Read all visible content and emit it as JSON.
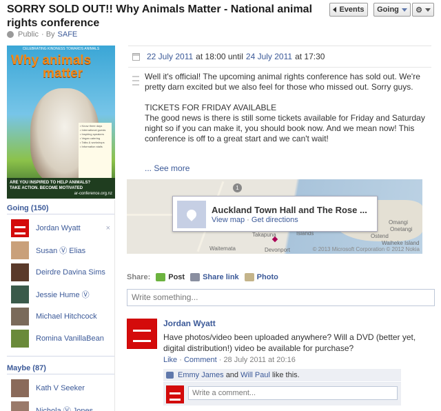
{
  "event": {
    "title": "SORRY SOLD OUT!! Why Animals Matter - National animal rights conference",
    "privacy": "Public",
    "by_prefix": "· By",
    "host": "SAFE"
  },
  "toolbar": {
    "events_label": "Events",
    "rsvp_label": "Going",
    "gear_icon": "gear-icon"
  },
  "poster": {
    "headline": "CELEBRATING KINDNESS TOWARDS ANIMALS",
    "title_line1": "Why animals",
    "title_line2": "matter",
    "bullets": "• Know three days\n• International guests\n• Inspiring speakers\n• Vegan catering\n• Talks & workshops\n• Information stalls",
    "bottom_line1": "ARE YOU INSPIRED TO HELP ANIMALS?",
    "bottom_line2": "TAKE ACTION. BECOME MOTIVATED",
    "url": "ar-conference.org.nz"
  },
  "sidebar": {
    "going_header": "Going (150)",
    "going": [
      {
        "name": "Jordan Wyatt",
        "avatar": "flag",
        "remove": "×"
      },
      {
        "name": "Susan Ⓥ Elias",
        "avatar": "photo",
        "color": "#c9a07a"
      },
      {
        "name": "Deirdre Davina Sims",
        "avatar": "photo",
        "color": "#5a3a2a"
      },
      {
        "name": "Jessie Hume Ⓥ",
        "avatar": "photo",
        "color": "#3a5a4a"
      },
      {
        "name": "Michael Hitchcock",
        "avatar": "photo",
        "color": "#7a6a5a"
      },
      {
        "name": "Romina VanillaBean",
        "avatar": "photo",
        "color": "#6a8a3a"
      }
    ],
    "maybe_header": "Maybe (87)",
    "maybe": [
      {
        "name": "Kath V Seeker",
        "avatar": "photo",
        "color": "#8a6a5a"
      },
      {
        "name": "Nichola Ⓥ Jones",
        "avatar": "photo",
        "color": "#9a7a6a"
      }
    ]
  },
  "when": {
    "start_date": "22 July 2011",
    "at1": "at 18:00 until",
    "end_date": "24 July 2011",
    "at2": "at 17:30"
  },
  "description": {
    "para1": "Well it's official! The upcoming animal rights conference has sold out. We're pretty darn excited but we also feel for those who missed out. Sorry guys.",
    "para2": "TICKETS FOR FRIDAY AVAILABLE\nThe good news is there is still some tickets available for Friday and Saturday night so if you can make it, you should book now. And we mean now! This conference is off to a great start and we can't wait!",
    "see_more": "... See more"
  },
  "map": {
    "place": "Auckland Town Hall and The Rose ...",
    "view_map": "View map",
    "sep": "·",
    "directions": "Get directions",
    "labels": [
      "Takapuna",
      "Waitemata",
      "Devonport",
      "Islands",
      "Waiheke Island",
      "Onetangi",
      "Ostend",
      "Omangi"
    ],
    "copyright": "© 2013 Microsoft Corporation © 2012 Nokia",
    "marker": "1"
  },
  "share": {
    "label": "Share:",
    "post": "Post",
    "share_link": "Share link",
    "photo": "Photo",
    "placeholder": "Write something..."
  },
  "post": {
    "author": "Jordan Wyatt",
    "text": "Have photos/video been uploaded anywhere? Will a DVD (better yet, digital distribution!) video be available for purchase?",
    "like": "Like",
    "comment": "Comment",
    "timestamp": "28 July 2011 at 20:16",
    "liker1": "Emmy James",
    "and": "and",
    "liker2": "Will Paul",
    "like_suffix": "like this.",
    "comment_placeholder": "Write a comment..."
  },
  "colors": {
    "link": "#3b5998",
    "flag_red": "#d40b0b"
  }
}
